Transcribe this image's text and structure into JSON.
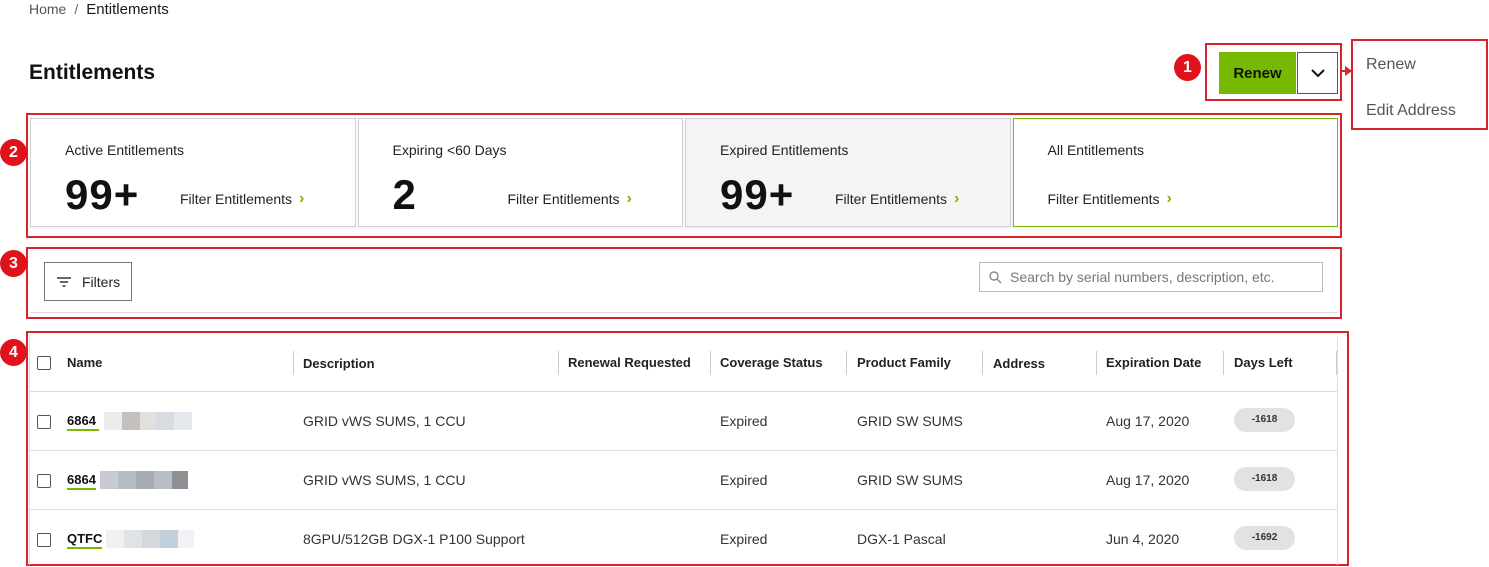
{
  "breadcrumb": {
    "home": "Home",
    "separator": "/",
    "current": "Entitlements"
  },
  "page_title": "Entitlements",
  "actions": {
    "renew_label": "Renew",
    "dropdown_items": [
      "Renew",
      "Edit Address"
    ]
  },
  "annotations": [
    "1",
    "2",
    "3",
    "4"
  ],
  "cards": [
    {
      "label": "Active Entitlements",
      "count": "99+",
      "link": "Filter Entitlements"
    },
    {
      "label": "Expiring <60 Days",
      "count": "2",
      "link": "Filter Entitlements"
    },
    {
      "label": "Expired Entitlements",
      "count": "99+",
      "link": "Filter Entitlements"
    },
    {
      "label": "All Entitlements",
      "count": "",
      "link": "Filter Entitlements"
    }
  ],
  "filters": {
    "button_label": "Filters",
    "search_placeholder": "Search by serial numbers, description, etc."
  },
  "table": {
    "columns": [
      "Name",
      "Description",
      "Renewal Requested",
      "Coverage Status",
      "Product Family",
      "Address",
      "Expiration Date",
      "Days Left"
    ],
    "rows": [
      {
        "name": "6864 ",
        "description": "GRID vWS SUMS, 1 CCU",
        "renewal_requested": "",
        "coverage_status": "Expired",
        "product_family": "GRID SW SUMS",
        "address": "",
        "expiration_date": "Aug 17, 2020",
        "days_left": "-1618"
      },
      {
        "name": "6864",
        "description": "GRID vWS SUMS, 1 CCU",
        "renewal_requested": "",
        "coverage_status": "Expired",
        "product_family": "GRID SW SUMS",
        "address": "",
        "expiration_date": "Aug 17, 2020",
        "days_left": "-1618"
      },
      {
        "name": "QTFC",
        "description": "8GPU/512GB DGX-1 P100 Support",
        "renewal_requested": "",
        "coverage_status": "Expired",
        "product_family": "DGX-1 Pascal",
        "address": "",
        "expiration_date": "Jun 4, 2020",
        "days_left": "-1692"
      }
    ]
  },
  "colors": {
    "accent": "#76b900",
    "annotation": "#d9232a"
  }
}
